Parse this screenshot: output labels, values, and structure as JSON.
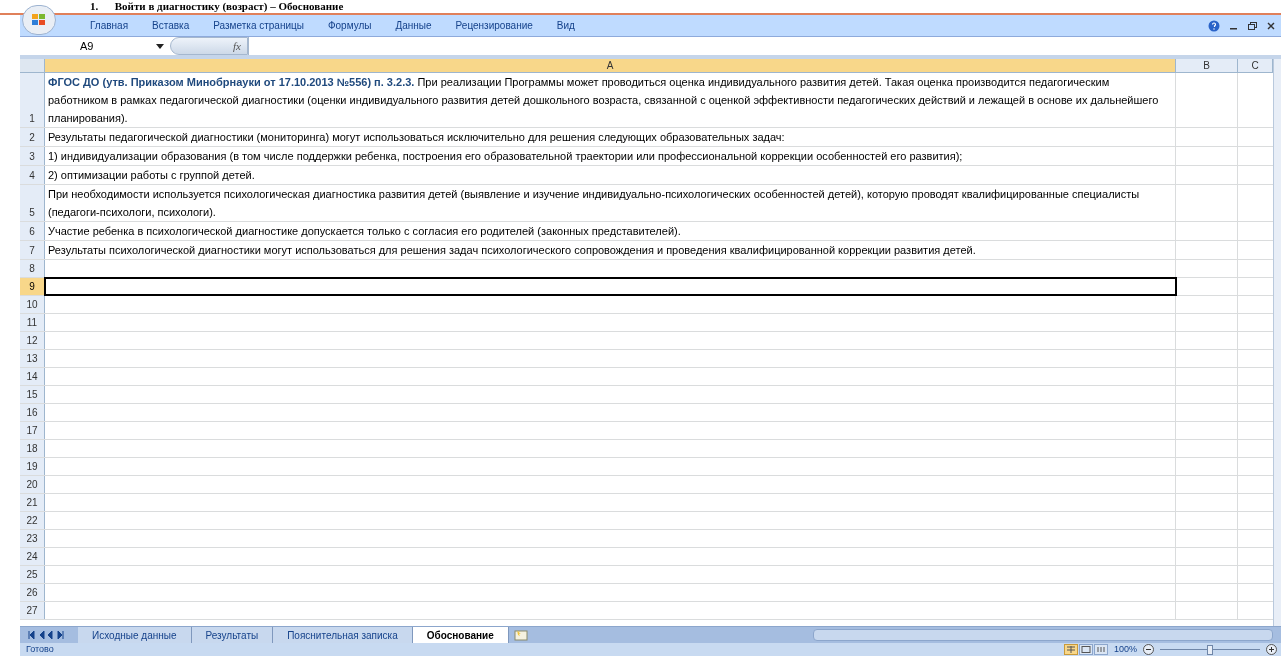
{
  "heading": "1.      Войти в диагностику (возраст) – Обоснование",
  "ribbon_tabs": [
    {
      "label": "Главная"
    },
    {
      "label": "Вставка"
    },
    {
      "label": "Разметка страницы"
    },
    {
      "label": "Формулы"
    },
    {
      "label": "Данные"
    },
    {
      "label": "Рецензирование"
    },
    {
      "label": "Вид"
    }
  ],
  "formula_bar": {
    "name_box": "A9",
    "fx": "fx"
  },
  "columns": [
    {
      "label": "A",
      "selected": true
    },
    {
      "label": "B",
      "selected": false
    },
    {
      "label": "C",
      "selected": false
    }
  ],
  "rows": [
    {
      "number": "1",
      "selected": false,
      "text": "**ФГОС ДО (утв. Приказом Минобрнауки от 17.10.2013 №556) п. 3.2.3.** При реализации Программы может проводиться оценка индивидуального развития детей. Такая оценка производится педагогическим работником в рамках педагогической диагностики (оценки индивидуального развития детей дошкольного возраста, связанной с оценкой эффективности педагогических действий и лежащей в основе их дальнейшего планирования)."
    },
    {
      "number": "2",
      "selected": false,
      "text": "Результаты педагогической диагностики (мониторинга) могут использоваться исключительно для решения следующих образовательных задач:"
    },
    {
      "number": "3",
      "selected": false,
      "text": "1) индивидуализации образования (в том числе поддержки ребенка, построения его образовательной траектории или профессиональной коррекции особенностей его развития);"
    },
    {
      "number": "4",
      "selected": false,
      "text": "2) оптимизации работы с группой детей."
    },
    {
      "number": "5",
      "selected": false,
      "text": "При необходимости используется психологическая диагностика развития детей (выявление и изучение индивидуально-психологических особенностей детей), которую проводят квалифицированные специалисты (педагоги-психологи, психологи)."
    },
    {
      "number": "6",
      "selected": false,
      "text": "Участие ребенка в психологической диагностике допускается только с согласия его родителей (законных представителей)."
    },
    {
      "number": "7",
      "selected": false,
      "text": "Результаты психологической диагностики могут использоваться для решения задач психологического сопровождения и проведения квалифицированной коррекции развития детей."
    },
    {
      "number": "8",
      "selected": false
    },
    {
      "number": "9",
      "selected": true
    },
    {
      "number": "10",
      "selected": false
    },
    {
      "number": "11",
      "selected": false
    },
    {
      "number": "12",
      "selected": false
    },
    {
      "number": "13",
      "selected": false
    },
    {
      "number": "14",
      "selected": false
    },
    {
      "number": "15",
      "selected": false
    },
    {
      "number": "16",
      "selected": false
    },
    {
      "number": "17",
      "selected": false
    },
    {
      "number": "18",
      "selected": false
    },
    {
      "number": "19",
      "selected": false
    },
    {
      "number": "20",
      "selected": false
    },
    {
      "number": "21",
      "selected": false
    },
    {
      "number": "22",
      "selected": false
    },
    {
      "number": "23",
      "selected": false
    },
    {
      "number": "24",
      "selected": false
    },
    {
      "number": "25",
      "selected": false
    },
    {
      "number": "26",
      "selected": false
    },
    {
      "number": "27",
      "selected": false
    }
  ],
  "sheet_tabs": [
    {
      "label": "Исходные данные",
      "selected": false
    },
    {
      "label": "Результаты",
      "selected": false
    },
    {
      "label": "Пояснительная записка",
      "selected": false
    },
    {
      "label": "Обоснование",
      "selected": true
    }
  ],
  "status_bar": {
    "status": "Готово",
    "zoom": "100%",
    "zoom_slider": {
      "level": 0.5
    }
  }
}
